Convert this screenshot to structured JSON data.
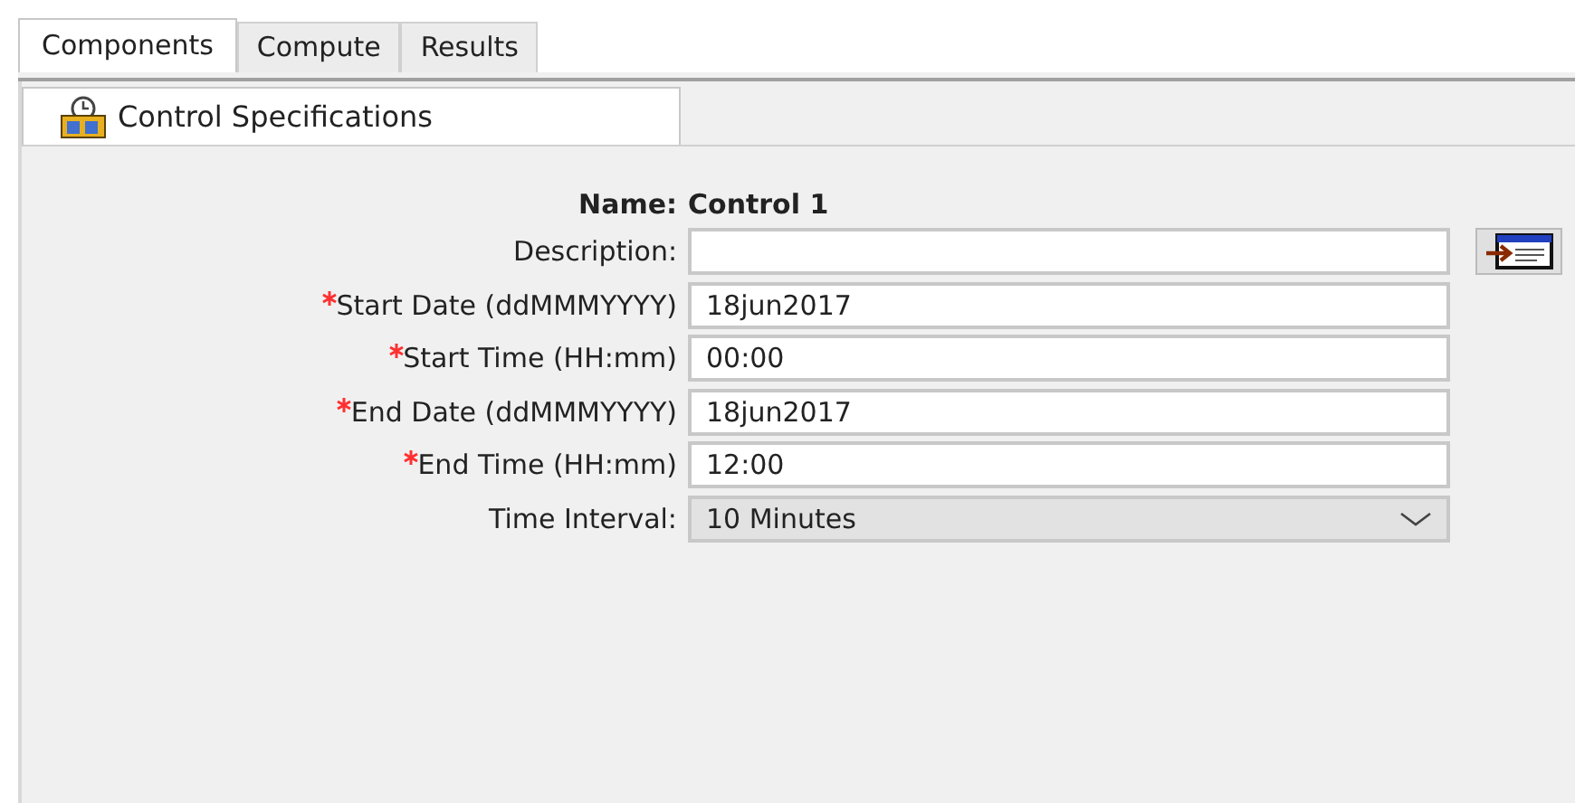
{
  "tabs": [
    {
      "label": "Components",
      "selected": true
    },
    {
      "label": "Compute",
      "selected": false
    },
    {
      "label": "Results",
      "selected": false
    }
  ],
  "subtabs": [
    {
      "label": "Control Specifications",
      "selected": true
    }
  ],
  "form": {
    "name_label": "Name:",
    "name_value": "Control 1",
    "fields": [
      {
        "kind": "text",
        "label": "Description:",
        "required": false,
        "has_editor_button": true
      },
      {
        "kind": "text",
        "label": "Start Date (ddMMMYYYY)",
        "required": true,
        "value": "18jun2017"
      },
      {
        "kind": "text",
        "label": "Start Time (HH:mm)",
        "required": true,
        "value": "00:00"
      },
      {
        "kind": "text",
        "label": "End Date (ddMMMYYYY)",
        "required": true,
        "value": "18jun2017"
      },
      {
        "kind": "text",
        "label": "End Time (HH:mm)",
        "required": true,
        "value": "12:00"
      },
      {
        "kind": "select",
        "label": "Time Interval:",
        "required": false,
        "value": "10 Minutes"
      }
    ]
  }
}
